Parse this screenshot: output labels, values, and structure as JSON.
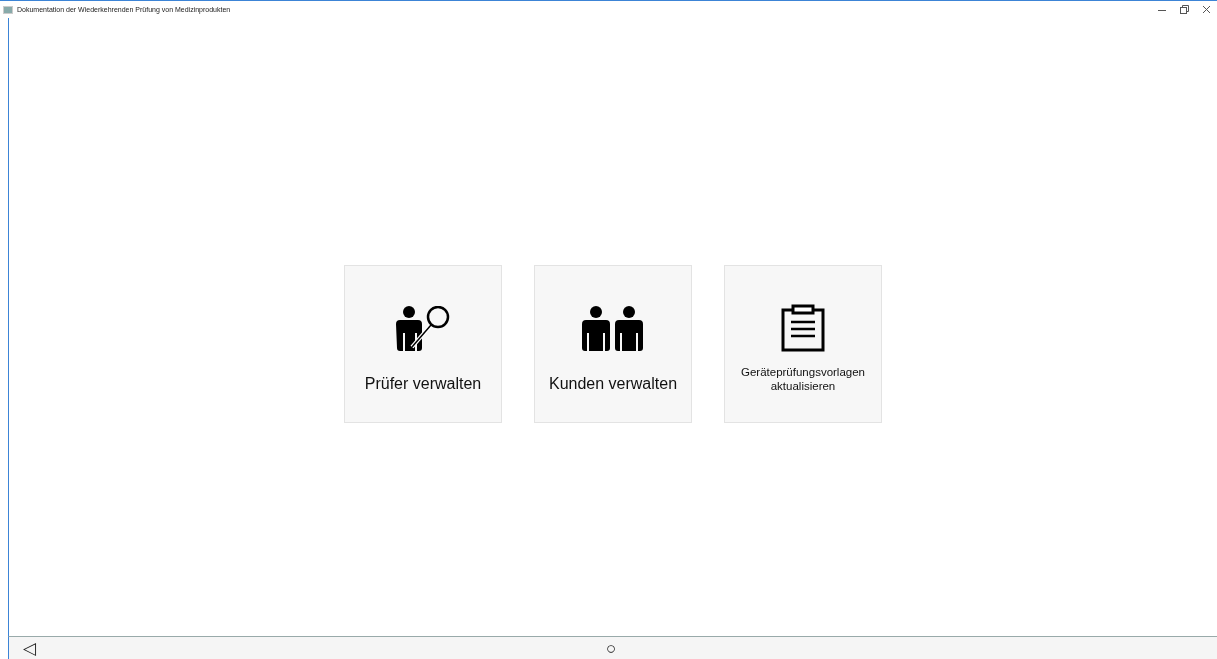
{
  "window": {
    "title": "Dokumentation der Wiederkehrenden Prüfung von Medizinprodukten"
  },
  "tiles": [
    {
      "label": "Prüfer verwalten"
    },
    {
      "label": "Kunden verwalten"
    },
    {
      "label": "Geräteprüfungsvorlagen aktualisieren"
    }
  ],
  "nav_bar": {
    "back": "◁",
    "home": "○"
  }
}
